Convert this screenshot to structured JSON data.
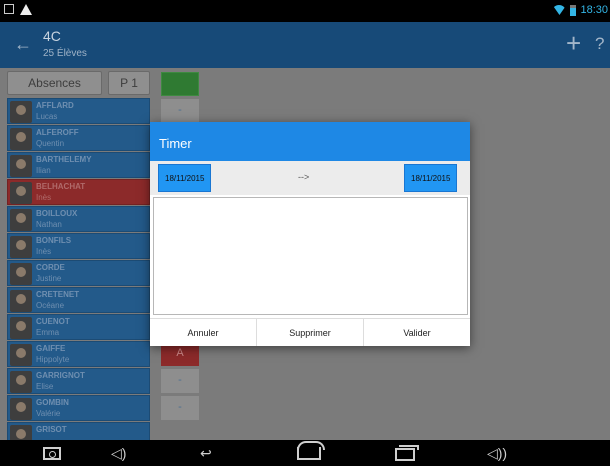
{
  "status_bar": {
    "time": "18:30"
  },
  "app_bar": {
    "back": "←",
    "title": "4C",
    "subtitle": "25 Élèves",
    "add": "+",
    "help": "?"
  },
  "toolbar": {
    "absences_label": "Absences",
    "period_label": "P 1"
  },
  "students": [
    {
      "last": "AFFLARD",
      "first": "Lucas"
    },
    {
      "last": "ALFEROFF",
      "first": "Quentin"
    },
    {
      "last": "BARTHELEMY",
      "first": "Ilian"
    },
    {
      "last": "BELHACHAT",
      "first": "Inès"
    },
    {
      "last": "BOILLOUX",
      "first": "Nathan"
    },
    {
      "last": "BONFILS",
      "first": "Inès"
    },
    {
      "last": "CORDE",
      "first": "Justine"
    },
    {
      "last": "CRETENET",
      "first": "Océane"
    },
    {
      "last": "CUENOT",
      "first": "Emma"
    },
    {
      "last": "GAIFFE",
      "first": "Hippolyte"
    },
    {
      "last": "GARRIGNOT",
      "first": "Elise"
    },
    {
      "last": "GOMBIN",
      "first": "Valérie"
    },
    {
      "last": "GRISOT",
      "first": ""
    }
  ],
  "marks": [
    {
      "row": 0,
      "text": "-"
    },
    {
      "row": 9,
      "text": "A"
    },
    {
      "row": 10,
      "text": "-"
    },
    {
      "row": 11,
      "text": "-"
    }
  ],
  "dialog": {
    "title": "Timer",
    "start_date": "18/11/2015",
    "arrow": "-->",
    "end_date": "18/11/2015",
    "text_value": "",
    "cancel_label": "Annuler",
    "delete_label": "Supprimer",
    "validate_label": "Valider"
  },
  "colors": {
    "dialog_header": "#1e88e5",
    "date_button": "#2196f3",
    "app_bar": "#174a78",
    "student_absent": "#8c2a2a",
    "status_accent": "#33b5e5"
  }
}
